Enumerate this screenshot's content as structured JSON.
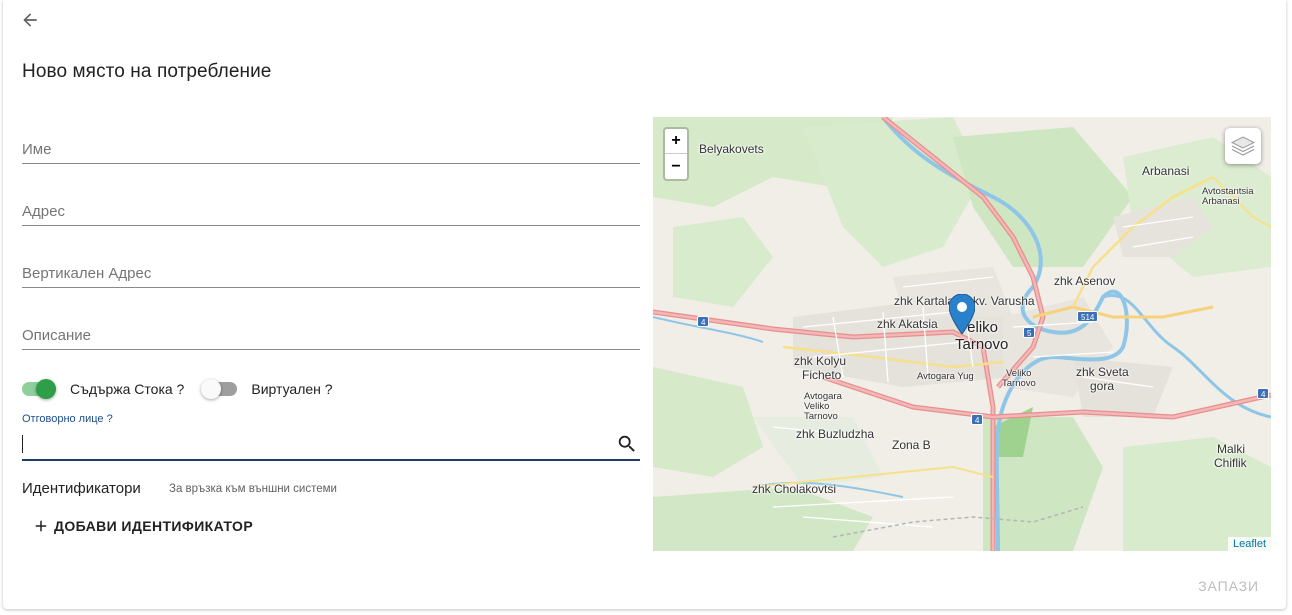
{
  "header": {
    "title": "Ново място на потребление",
    "back_icon": "arrow-back-icon"
  },
  "form": {
    "name_placeholder": "Име",
    "address_placeholder": "Адрес",
    "vertical_address_placeholder": "Вертикален Адрес",
    "description_placeholder": "Описание",
    "contains_goods_label": "Съдържа Стока ?",
    "contains_goods_checked": true,
    "virtual_label": "Виртуален ?",
    "virtual_checked": false,
    "responsible_label": "Отговорно лице ?",
    "responsible_value": ""
  },
  "identifiers": {
    "title": "Идентификатори",
    "subtitle": "За връзка към външни системи",
    "add_button_label": "ДОБАВИ ИДЕНТИФИКАТОР"
  },
  "map": {
    "zoom_in_label": "+",
    "zoom_out_label": "−",
    "attribution": "Leaflet",
    "labels": {
      "belyakovets": "Belyakovets",
      "arbanasi": "Arbanasi",
      "avtostantsia_arbanasi_1": "Avtostantsia",
      "avtostantsia_arbanasi_2": "Arbanasi",
      "zhk_asenov": "zhk Asenov",
      "zhk_kartala": "zhk Kartala",
      "kv_varusha": "kv. Varusha",
      "zhk_akatsia": "zhk Akatsia",
      "veliko_tarnovo_1": "Veliko",
      "veliko_tarnovo_2": "Tarnovo",
      "zhk_kolyu_ficheto_1": "zhk Kolyu",
      "zhk_kolyu_ficheto_2": "Ficheto",
      "avtogara_yug": "Avtogara Yug",
      "veliko_tarnovo_small_1": "Veliko",
      "veliko_tarnovo_small_2": "Tarnovo",
      "avtogara_vt_1": "Avtogara",
      "avtogara_vt_2": "Veliko",
      "avtogara_vt_3": "Tarnovo",
      "zhk_sveta_gora_1": "zhk Sveta",
      "zhk_sveta_gora_2": "gora",
      "zhk_buzludzha": "zhk Buzludzha",
      "zona_b": "Zona B",
      "malki_chiflik_1": "Malki",
      "malki_chiflik_2": "Chiflik",
      "zhk_cholakovtsi": "zhk Cholakovtsi"
    },
    "road_shields": {
      "r4_west": "4",
      "r4_center": "4",
      "r4_east": "4",
      "r5": "5",
      "r514": "514"
    }
  },
  "footer": {
    "save_label": "ЗАПАЗИ"
  },
  "colors": {
    "accent_green": "#2e9e48",
    "focus_blue": "#1f3b66",
    "disabled_text": "#bdbdbd",
    "marker_blue": "#2a81cb"
  }
}
